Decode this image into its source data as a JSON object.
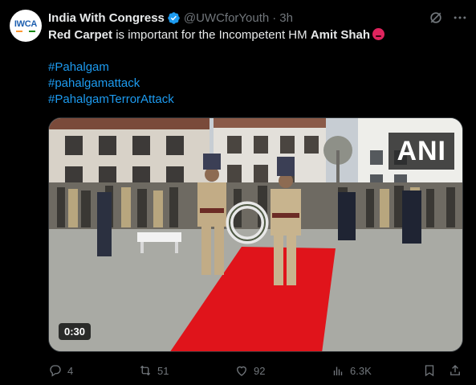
{
  "author": {
    "display_name": "India With Congress",
    "handle": "@UWCforYouth",
    "dot": "·",
    "time": "3h",
    "avatar_text": "IWCA",
    "verified": true
  },
  "tweet": {
    "parts": [
      "Red Carpet",
      " is important for the Incompetent HM ",
      "Amit Shah"
    ],
    "emoji": "angry-face-icon",
    "hashtags": [
      "#Pahalgam",
      "#pahalgamattack",
      "#PahalgamTerrorAttack"
    ]
  },
  "media": {
    "watermark": "ANI",
    "duration": "0:30"
  },
  "actions": {
    "replies": "4",
    "retweets": "51",
    "likes": "92",
    "views": "6.3K"
  },
  "colors": {
    "background": "#000000",
    "text": "#e7e9ea",
    "muted": "#71767b",
    "link": "#1d9bf0",
    "verified": "#1d9bf0",
    "red_carpet": "#e0141b"
  }
}
